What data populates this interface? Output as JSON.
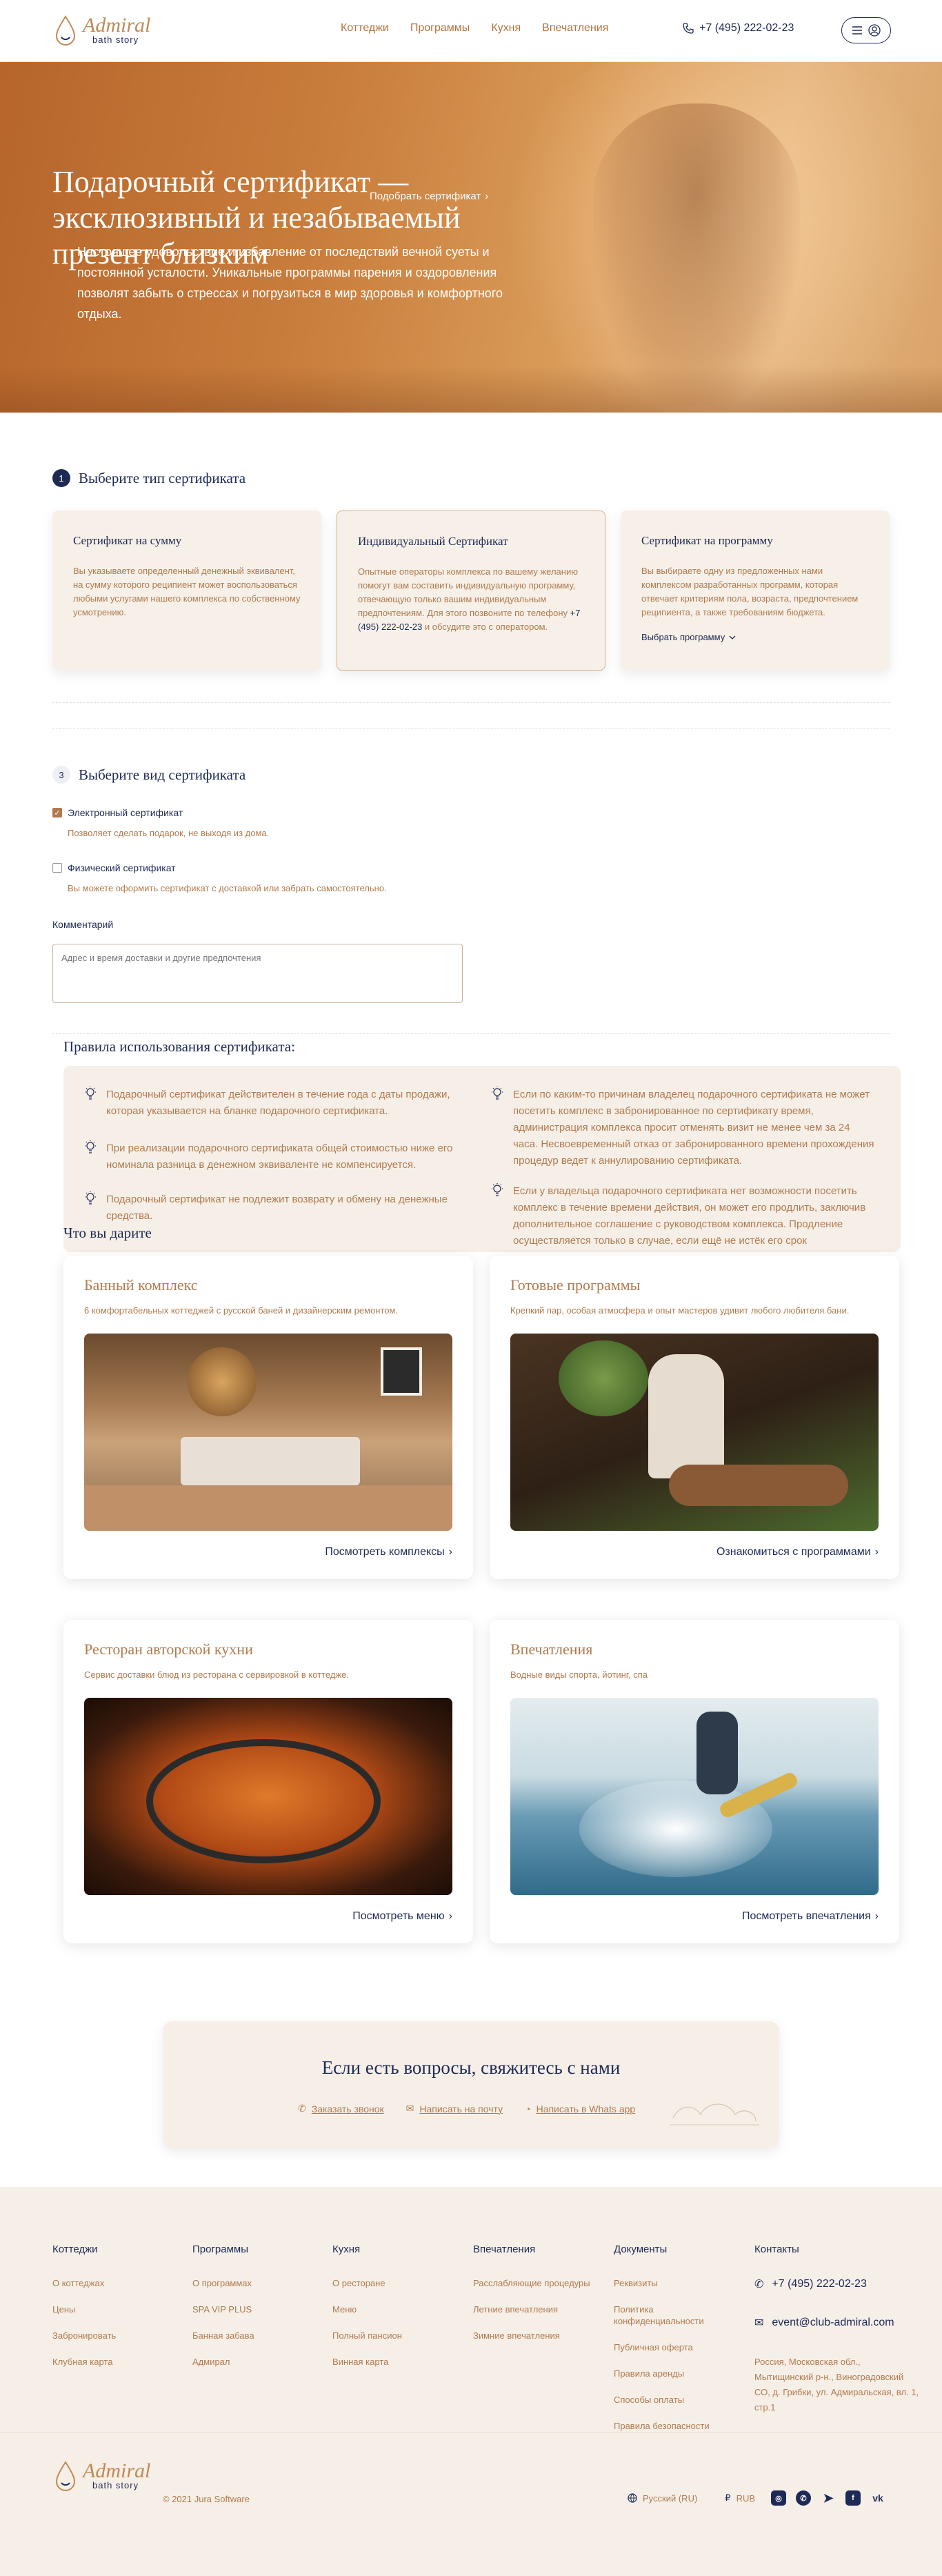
{
  "brand": {
    "name": "Admiral",
    "tagline": "bath story"
  },
  "nav": {
    "items": [
      "Коттеджи",
      "Программы",
      "Кухня",
      "Впечатления"
    ]
  },
  "header": {
    "phone": "+7 (495) 222-02-23"
  },
  "hero": {
    "title": "Подарочный сертификат — эксклюзивный и незабываемый презент близким",
    "pick_link": "Подобрать сертификат",
    "text": "Настоящее удовольствие и избавление от последствий вечной суеты и постоянной усталости. Уникальные программы парения и оздоровления позволят забыть о стрессах и погрузиться в мир здоровья и комфортного отдыха."
  },
  "step1": {
    "num": "1",
    "title": "Выберите тип сертификата",
    "cards": [
      {
        "title": "Сертификат на сумму",
        "text": "Вы указываете определенный денежный эквивалент, на сумму которого реципиент может воспользоваться любыми услугами нашего комплекса по собственному усмотрению."
      },
      {
        "title": "Индивидуальный Сертификат",
        "text": "Опытные операторы комплекса по вашему желанию помогут вам составить индивидуальную программу, отвечающую только вашим индивидуальным предпочтениям. Для этого позвоните по телефону",
        "phone": "+7 (495) 222-02-23",
        "text_after": "и обсудите это с оператором."
      },
      {
        "title": "Сертификат на программу",
        "text": "Вы выбираете одну из предложенных нами комплексом разработанных программ, которая отвечает критериям пола, возраста, предпочтением реципиента, а также требованиям бюджета.",
        "link": "Выбрать программу"
      }
    ]
  },
  "step2": {
    "num": "3",
    "title": "Выберите вид сертификата",
    "options": [
      {
        "label": "Электронный сертификат",
        "sub": "Позволяет сделать подарок, не выходя из дома.",
        "checked": true
      },
      {
        "label": "Физический сертификат",
        "sub": "Вы можете оформить сертификат с доставкой или забрать самостоятельно.",
        "checked": false
      }
    ],
    "comment_label": "Комментарий",
    "comment_placeholder": "Адрес и время доставки и другие предпочтения"
  },
  "rules": {
    "title": "Правила использования сертификата:",
    "left": [
      "Подарочный сертификат действителен в течение года с даты продажи, которая указывается на бланке подарочного сертификата.",
      "При реализации подарочного сертификата общей стоимостью ниже его номинала разница в денежном эквиваленте не компенсируется.",
      "Подарочный сертификат не подлежит возврату и обмену на денежные средства."
    ],
    "right": [
      "Если по каким-то причинам владелец подарочного сертификата не может посетить комплекс в забронированное по сертификату время, администрация комплекса просит отменять визит не менее чем за 24 часа. Несвоевременный отказ от забронированного времени прохождения процедур ведет к аннулированию сертификата.",
      "Если у владельца подарочного сертификата нет возможности посетить комплекс в течение времени действия, он может его продлить, заключив дополнительное соглашение с руководством комплекса. Продление осуществляется только в случае, если ещё не истёк его срок"
    ]
  },
  "gifts": {
    "title": "Что вы дарите",
    "cards": [
      {
        "title": "Банный комплекс",
        "text": "6 комфортабельных коттеджей с русской баней и дизайнерским ремонтом.",
        "link": "Посмотреть комплексы"
      },
      {
        "title": "Готовые программы",
        "text": "Крепкий пар, особая атмосфера и опыт мастеров удивит любого любителя бани.",
        "link": "Ознакомиться с программами"
      },
      {
        "title": "Ресторан авторской кухни",
        "text": "Сервис доставки блюд из ресторана с сервировкой в коттедже.",
        "link": "Посмотреть меню"
      },
      {
        "title": "Впечатления",
        "text": "Водные виды спорта, йотинг, спа",
        "link": "Посмотреть впечатления"
      }
    ]
  },
  "contact": {
    "title": "Если есть вопросы, свяжитесь с нами",
    "links": [
      "Заказать звонок",
      "Написать на почту",
      "Написать в Whats app"
    ]
  },
  "footer": {
    "cols": [
      {
        "title": "Коттеджи",
        "items": [
          "О коттеджах",
          "Цены",
          "Забронировать",
          "Клубная карта"
        ]
      },
      {
        "title": "Программы",
        "items": [
          "О программах",
          "SPA VIP PLUS",
          "Банная забава",
          "Адмирал"
        ]
      },
      {
        "title": "Кухня",
        "items": [
          "О ресторане",
          "Меню",
          "Полный пансион",
          "Винная карта"
        ]
      },
      {
        "title": "Впечатления",
        "items": [
          "Расслабляющие процедуры",
          "Летние впечатления",
          "Зимние впечатления"
        ]
      },
      {
        "title": "Документы",
        "items": [
          "Реквизиты",
          "Политика конфиденциальности",
          "Публичная оферта",
          "Правила аренды",
          "Способы оплаты",
          "Правила безопасности"
        ]
      }
    ],
    "contacts_title": "Контакты",
    "phone": "+7 (495) 222-02-23",
    "email": "event@club-admiral.com",
    "address": "Россия, Московская обл., Мытищинский р-н., Виноградовский СО, д. Грибки, ул. Адмиральская, вл. 1, стр.1",
    "copyright": "© 2021 Jura Software",
    "language": "Русский (RU)",
    "currency": "RUB",
    "currency_symbol": "₽",
    "social": [
      "instagram-icon",
      "whatsapp-icon",
      "telegram-icon",
      "facebook-icon",
      "vk-icon"
    ]
  },
  "colors": {
    "navy": "#1d2a55",
    "bronze": "#b07a4e",
    "cream": "#f6efe8",
    "hero": "#c97e3d"
  }
}
